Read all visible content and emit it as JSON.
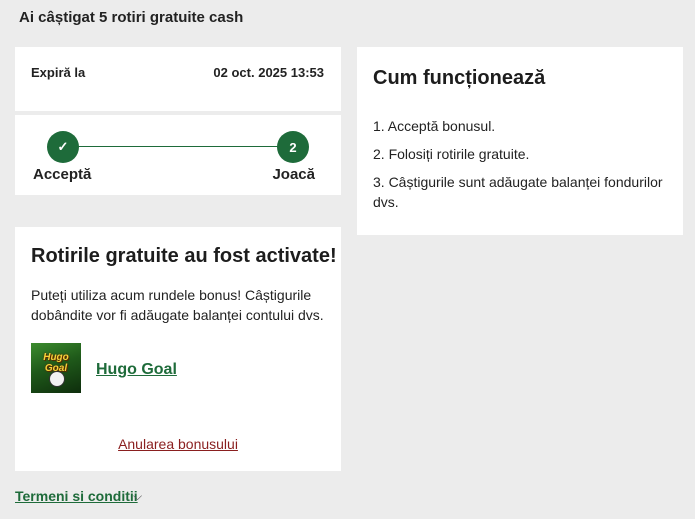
{
  "header": {
    "title": "Ai câștigat 5 rotiri gratuite cash"
  },
  "expiry": {
    "label": "Expiră la",
    "value": "02 oct. 2025 13:53"
  },
  "steps": {
    "step1": {
      "icon": "checkmark-icon",
      "symbol": "✓",
      "label": "Acceptă"
    },
    "step2": {
      "number": "2",
      "label": "Joacă"
    }
  },
  "active": {
    "title": "Rotirile gratuite au fost activate!",
    "description": "Puteți utiliza acum rundele bonus! Câștigurile dobândite vor fi adăugate balanței contului dvs.",
    "game": {
      "name": "Hugo Goal",
      "thumb_text": "Hugo Goal",
      "thumb_icon": "game-thumbnail"
    },
    "cancel_label": "Anularea bonusului"
  },
  "terms": {
    "label": "Termeni si conditii",
    "chevron": "⌵"
  },
  "how": {
    "title": "Cum funcționează",
    "items": [
      "1.  Acceptă bonusul.",
      "2.  Folosiți rotirile gratuite.",
      "3.  Câștigurile sunt adăugate balanței fondurilor dvs."
    ]
  },
  "colors": {
    "accent": "#1e6b3a",
    "danger_link": "#8a1f1f",
    "background": "#ececec"
  }
}
